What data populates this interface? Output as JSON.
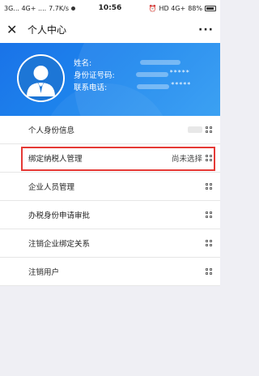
{
  "status_bar": {
    "left": "3G... 4G+ ....",
    "speed": "7.7K/s",
    "time": "10:56",
    "right": "HD 4G+",
    "battery": "88%"
  },
  "navbar": {
    "title": "个人中心"
  },
  "profile": {
    "name_label": "姓名:",
    "id_label": "身份证号码:",
    "id_value": "*****",
    "phone_label": "联系电话:",
    "phone_value": "*****"
  },
  "menu": {
    "items": [
      {
        "label": "个人身份信息",
        "value": ""
      },
      {
        "label": "绑定纳税人管理",
        "value": "尚未选择"
      },
      {
        "label": "企业人员管理",
        "value": ""
      },
      {
        "label": "办税身份申请审批",
        "value": ""
      },
      {
        "label": "注销企业绑定关系",
        "value": ""
      },
      {
        "label": "注销用户",
        "value": ""
      }
    ]
  },
  "colors": {
    "banner": "#1a73e8",
    "highlight": "#e53935"
  }
}
